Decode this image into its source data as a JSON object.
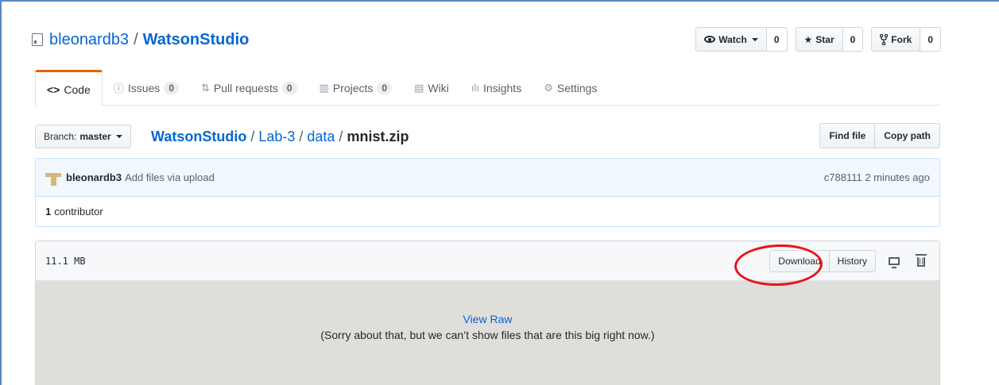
{
  "repo": {
    "owner": "bleonardb3",
    "separator": "/",
    "name": "WatsonStudio"
  },
  "actions": {
    "watch_label": "Watch",
    "watch_count": "0",
    "star_label": "Star",
    "star_count": "0",
    "fork_label": "Fork",
    "fork_count": "0"
  },
  "tabs": [
    {
      "label": "Code",
      "icon": "code-icon",
      "selected": true
    },
    {
      "label": "Issues",
      "icon": "issue-icon",
      "count": "0"
    },
    {
      "label": "Pull requests",
      "icon": "pull-request-icon",
      "count": "0"
    },
    {
      "label": "Projects",
      "icon": "project-icon",
      "count": "0"
    },
    {
      "label": "Wiki",
      "icon": "book-icon"
    },
    {
      "label": "Insights",
      "icon": "graph-icon"
    },
    {
      "label": "Settings",
      "icon": "gear-icon"
    }
  ],
  "branch": {
    "prefix": "Branch:",
    "name": "master"
  },
  "breadcrumb": {
    "root": "WatsonStudio",
    "sep": "/",
    "dir1": "Lab-3",
    "dir2": "data",
    "file": "mnist.zip"
  },
  "file_nav": {
    "find_file": "Find file",
    "copy_path": "Copy path"
  },
  "commit": {
    "author": "bleonardb3",
    "message": "Add files via upload",
    "sha": "c788111",
    "time": "2 minutes ago"
  },
  "contributors": {
    "count": "1",
    "label": "contributor"
  },
  "file": {
    "size": "11.1 MB",
    "download_label": "Download",
    "history_label": "History",
    "view_raw": "View Raw",
    "too_big_msg": "(Sorry about that, but we can’t show files that are this big right now.)"
  },
  "colors": {
    "link": "#0366d6",
    "tab_accent": "#e36209",
    "annotation": "#e8131a",
    "commit_bg": "#f1f8ff"
  }
}
